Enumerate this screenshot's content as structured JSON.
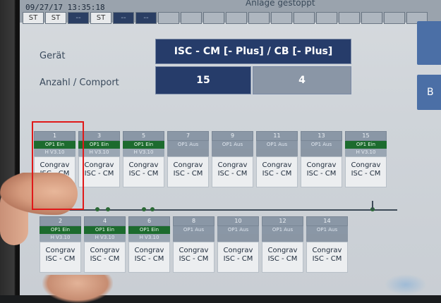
{
  "header": {
    "timestamp": "09/27/17 13:35:18",
    "status_text": "Anlage gestoppt",
    "station_buttons": [
      {
        "label": "ST",
        "style": "light"
      },
      {
        "label": "ST",
        "style": "light"
      },
      {
        "label": "--",
        "style": "dark"
      },
      {
        "label": "ST",
        "style": "light"
      },
      {
        "label": "--",
        "style": "dark"
      },
      {
        "label": "--",
        "style": "dark"
      },
      {
        "label": "",
        "style": "empty"
      },
      {
        "label": "",
        "style": "empty"
      },
      {
        "label": "",
        "style": "empty"
      },
      {
        "label": "",
        "style": "empty"
      },
      {
        "label": "",
        "style": "empty"
      },
      {
        "label": "",
        "style": "empty"
      },
      {
        "label": "",
        "style": "empty"
      },
      {
        "label": "",
        "style": "empty"
      },
      {
        "label": "",
        "style": "empty"
      },
      {
        "label": "",
        "style": "empty"
      },
      {
        "label": "",
        "style": "empty"
      },
      {
        "label": "",
        "style": "empty"
      }
    ]
  },
  "config": {
    "device_label": "Gerät",
    "device_value": "ISC - CM [- Plus] / CB [- Plus]",
    "count_label": "Anzahl / Comport",
    "count_value": "15",
    "comport_value": "4",
    "side_button_label": "B"
  },
  "top_row": [
    {
      "num": "1",
      "op": "OP1 Ein",
      "op_on": true,
      "ver": "H V3.10",
      "line1": "Congrav",
      "line2": "ISC - CM"
    },
    {
      "num": "3",
      "op": "OP1 Ein",
      "op_on": true,
      "ver": "H V3.10",
      "line1": "Congrav",
      "line2": "ISC - CM"
    },
    {
      "num": "5",
      "op": "OP1 Ein",
      "op_on": true,
      "ver": "H V3.10",
      "line1": "Congrav",
      "line2": "ISC - CM"
    },
    {
      "num": "7",
      "op": "OP1 Aus",
      "op_on": false,
      "ver": "",
      "line1": "Congrav",
      "line2": "ISC - CM"
    },
    {
      "num": "9",
      "op": "OP1 Aus",
      "op_on": false,
      "ver": "",
      "line1": "Congrav",
      "line2": "ISC - CM"
    },
    {
      "num": "11",
      "op": "OP1 Aus",
      "op_on": false,
      "ver": "",
      "line1": "Congrav",
      "line2": "ISC - CM"
    },
    {
      "num": "13",
      "op": "OP1 Aus",
      "op_on": false,
      "ver": "",
      "line1": "Congrav",
      "line2": "ISC - CM"
    },
    {
      "num": "15",
      "op": "OP1 Ein",
      "op_on": true,
      "ver": "H V3.10",
      "line1": "Congrav",
      "line2": "ISC - CM"
    }
  ],
  "bottom_row": [
    {
      "num": "2",
      "op": "OP1 Ein",
      "op_on": true,
      "ver": "H V3.10",
      "line1": "Congrav",
      "line2": "ISC - CM"
    },
    {
      "num": "4",
      "op": "OP1 Ein",
      "op_on": true,
      "ver": "H V3.10",
      "line1": "Congrav",
      "line2": "ISC - CM"
    },
    {
      "num": "6",
      "op": "OP1 Ein",
      "op_on": true,
      "ver": "H V3.10",
      "line1": "Congrav",
      "line2": "ISC - CM"
    },
    {
      "num": "8",
      "op": "OP1 Aus",
      "op_on": false,
      "ver": "",
      "line1": "Congrav",
      "line2": "ISC - CM"
    },
    {
      "num": "10",
      "op": "OP1 Aus",
      "op_on": false,
      "ver": "",
      "line1": "Congrav",
      "line2": "ISC - CM"
    },
    {
      "num": "12",
      "op": "OP1 Aus",
      "op_on": false,
      "ver": "",
      "line1": "Congrav",
      "line2": "ISC - CM"
    },
    {
      "num": "14",
      "op": "OP1 Aus",
      "op_on": false,
      "ver": "",
      "line1": "Congrav",
      "line2": "ISC - CM"
    }
  ],
  "colors": {
    "accent": "#263c6a",
    "op_on": "#1c6b2e",
    "highlight": "#e01919"
  }
}
